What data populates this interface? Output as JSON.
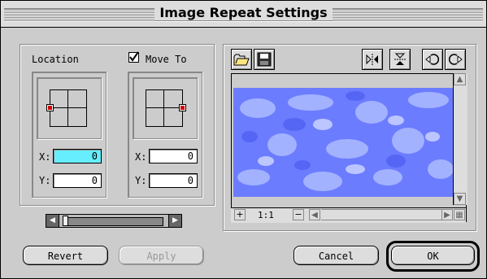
{
  "window": {
    "title": "Image Repeat Settings"
  },
  "location": {
    "label": "Location",
    "x_label": "X:",
    "y_label": "Y:",
    "x_value": "0",
    "y_value": "0"
  },
  "move_to": {
    "label": "Move To",
    "checked": true,
    "x_label": "X:",
    "y_label": "Y:",
    "x_value": "0",
    "y_value": "0"
  },
  "preview": {
    "zoom": "1:1"
  },
  "buttons": {
    "revert": "Revert",
    "apply": "Apply",
    "cancel": "Cancel",
    "ok": "OK"
  },
  "colors": {
    "active_field": "#66eeff",
    "preview_base": "#6c7cff",
    "preview_light": "#a8b8ff",
    "preview_dark": "#4c5cf0",
    "anchor": "#cc0000"
  }
}
